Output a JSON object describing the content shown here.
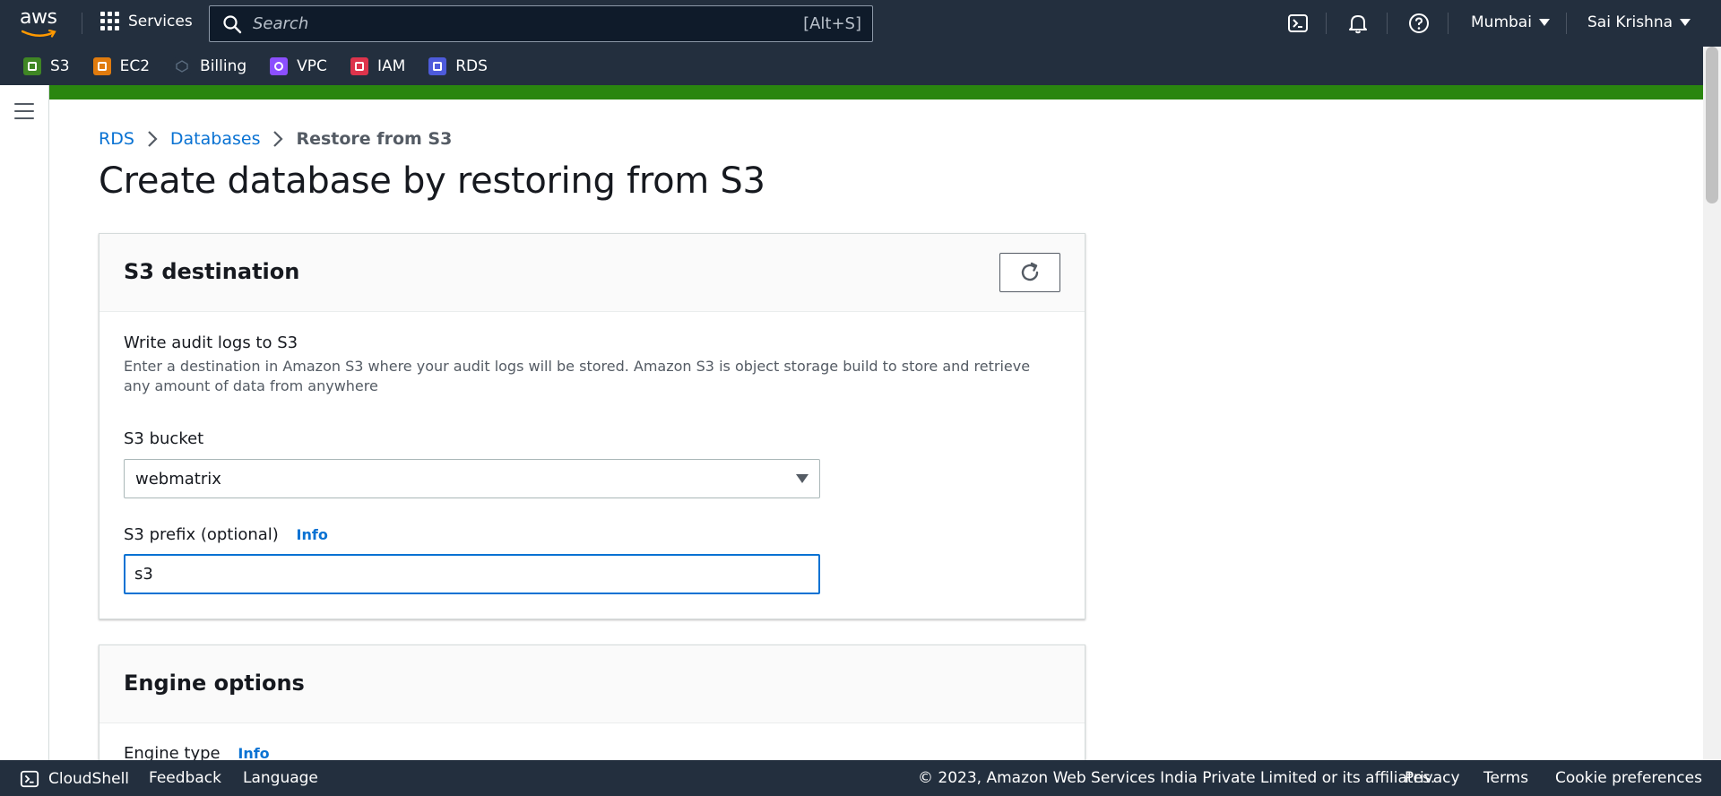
{
  "topnav": {
    "logo_text": "aws",
    "services_label": "Services",
    "search_placeholder": "Search",
    "search_shortcut": "[Alt+S]",
    "region": "Mumbai",
    "user": "Sai Krishna",
    "icons": [
      "cloudshell-icon",
      "bell-icon",
      "help-icon"
    ]
  },
  "favorites": [
    {
      "label": "S3",
      "icon": "s3-icon",
      "color": "#3f8624"
    },
    {
      "label": "EC2",
      "icon": "ec2-icon",
      "color": "#e07b0e"
    },
    {
      "label": "Billing",
      "icon": "billing-icon",
      "color": "#232f3e"
    },
    {
      "label": "VPC",
      "icon": "vpc-icon",
      "color": "#8c4fff"
    },
    {
      "label": "IAM",
      "icon": "iam-icon",
      "color": "#dd344c"
    },
    {
      "label": "RDS",
      "icon": "rds-icon",
      "color": "#4d5bdb"
    }
  ],
  "breadcrumb": {
    "items": [
      "RDS",
      "Databases"
    ],
    "current": "Restore from S3"
  },
  "page_title": "Create database by restoring from S3",
  "s3_destination": {
    "title": "S3 destination",
    "write_logs_title": "Write audit logs to S3",
    "write_logs_desc": "Enter a destination in Amazon S3 where your audit logs will be stored. Amazon S3 is object storage build to store and retrieve any amount of data from anywhere",
    "bucket_label": "S3 bucket",
    "bucket_value": "webmatrix",
    "prefix_label": "S3 prefix (optional)",
    "prefix_info": "Info",
    "prefix_value": "s3"
  },
  "engine_options": {
    "title": "Engine options",
    "engine_type_label": "Engine type",
    "engine_type_info": "Info"
  },
  "footer": {
    "cloudshell": "CloudShell",
    "feedback": "Feedback",
    "language": "Language",
    "copyright": "© 2023, Amazon Web Services India Private Limited or its affiliates.",
    "privacy": "Privacy",
    "terms": "Terms",
    "cookie": "Cookie preferences"
  },
  "colors": {
    "nav_bg": "#232f3e",
    "accent_blue": "#0972d3",
    "flash_green": "#2a860f"
  }
}
